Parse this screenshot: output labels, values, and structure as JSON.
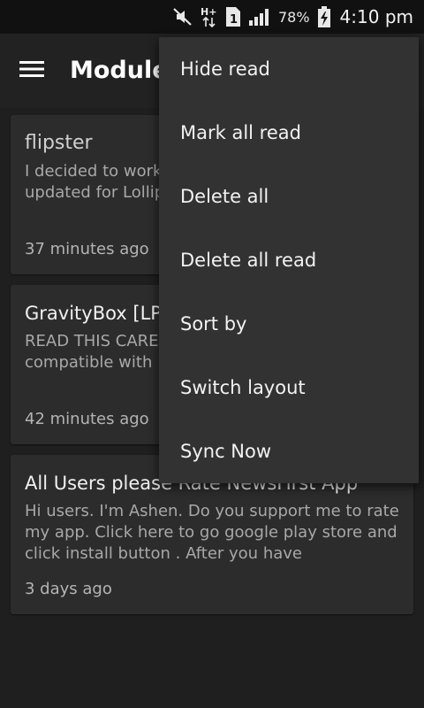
{
  "status_bar": {
    "battery_percent": "78%",
    "time": "4:10 pm",
    "icons": [
      "mute-icon",
      "hplus-data-icon",
      "sim-1-icon",
      "signal-icon",
      "battery-charging-icon"
    ]
  },
  "app_bar": {
    "title": "Module",
    "menu_icon": "hamburger-menu-icon"
  },
  "cards": [
    {
      "title": "flipster",
      "body": "I decided to work on a module hasn't been updated for Lollipop. (I do not",
      "time": "37 minutes ago"
    },
    {
      "title": "GravityBox [LP]",
      "body": "READ THIS CAREFULLY has been tested on be compatible with",
      "time": "42 minutes ago"
    },
    {
      "title": "All Users please Rate NewsFirst App",
      "body": "Hi users. I'm Ashen. Do you support me to rate my app. Click here to go google play store and click install button . After you have",
      "time": "3 days ago"
    }
  ],
  "overflow_menu": {
    "items": [
      "Hide read",
      "Mark all read",
      "Delete all",
      "Delete all read",
      "Sort by",
      "Switch layout",
      "Sync Now"
    ]
  }
}
